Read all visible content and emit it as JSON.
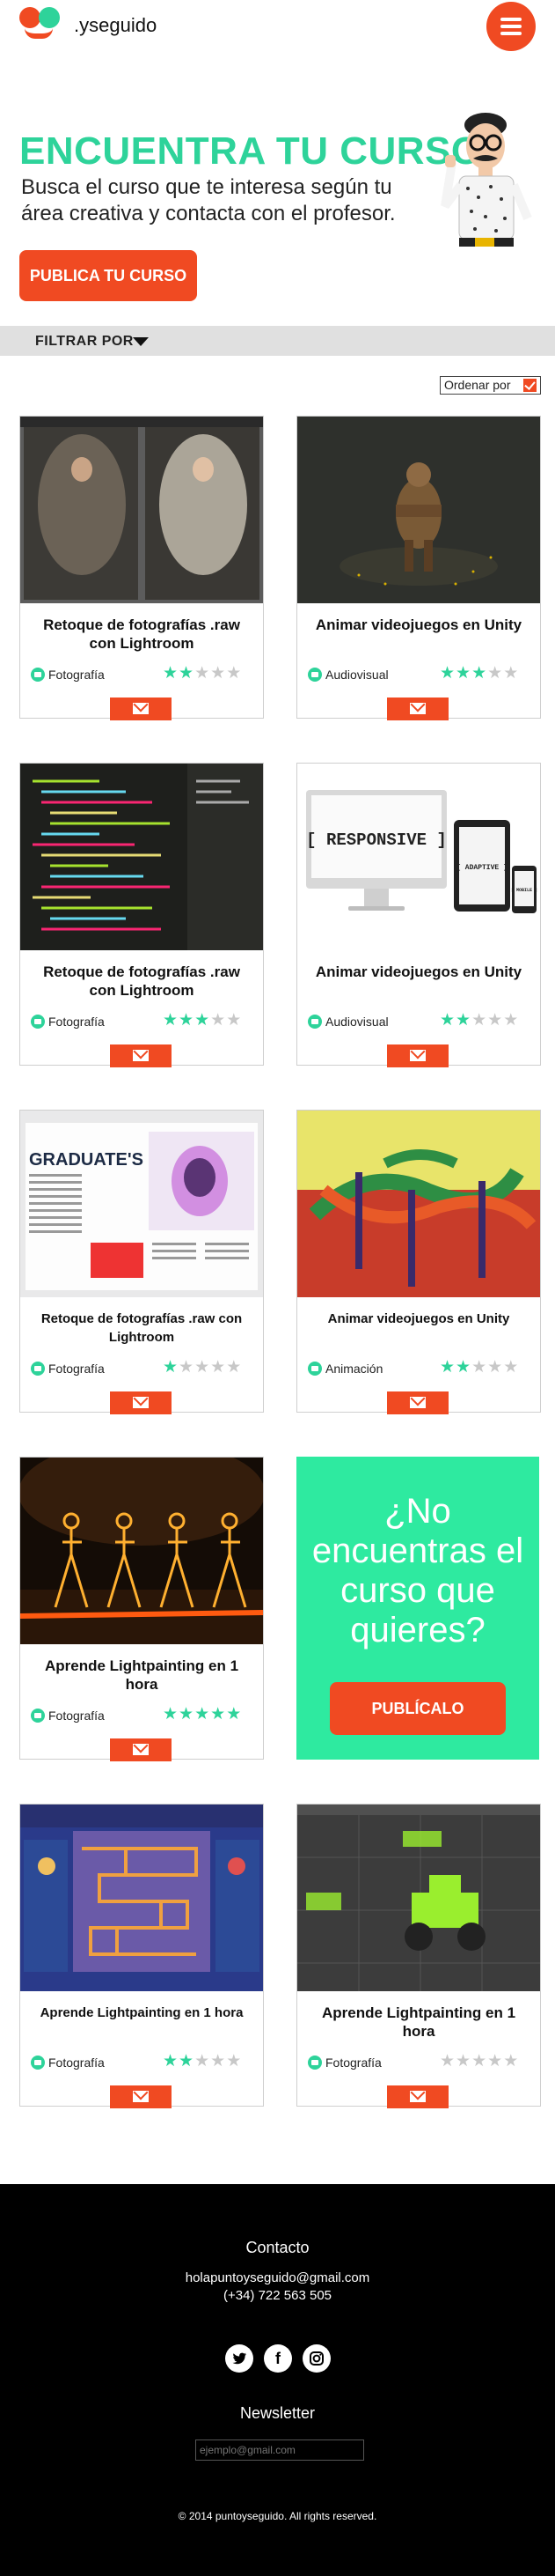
{
  "brand": {
    "name": ".yseguido"
  },
  "hero": {
    "title": "ENCUENTRA TU CURSO",
    "subtitle": "Busca el curso que te interesa según tu área creativa y contacta con el profesor.",
    "cta_label": "PUBLICA TU CURSO"
  },
  "filter": {
    "label": "FILTRAR POR",
    "order_label": "Ordenar por"
  },
  "colors": {
    "accent": "#f04a22",
    "brand_green": "#2ed39a",
    "promo_green": "#2eeaa0"
  },
  "courses": [
    {
      "title": "Retoque de fotografías .raw con Lightroom",
      "category": "Fotografía",
      "rating": 2
    },
    {
      "title": "Animar videojuegos en Unity",
      "category": "Audiovisual",
      "rating": 3
    },
    {
      "title": "Retoque de fotografías .raw con Lightroom",
      "category": "Fotografía",
      "rating": 3
    },
    {
      "title": "Animar videojuegos en Unity",
      "category": "Audiovisual",
      "rating": 2
    },
    {
      "title": "Retoque de fotografías .raw con Lightroom",
      "category": "Fotografía",
      "rating": 1
    },
    {
      "title": "Animar videojuegos en Unity",
      "category": "Animación",
      "rating": 2
    },
    {
      "title": "Aprende Lightpainting en 1 hora",
      "category": "Fotografía",
      "rating": 5
    },
    {
      "title": "Aprende Lightpainting en 1 hora",
      "category": "Fotografía",
      "rating": 2
    },
    {
      "title": "Aprende Lightpainting en 1 hora",
      "category": "Fotografía",
      "rating": 0
    }
  ],
  "image_texts": {
    "responsive": "[ RESPONSIVE ]",
    "adaptive": "[ ADAPTIVE ]",
    "mobile": "[ MOBILE ]",
    "magazine": "GRADUATE'S"
  },
  "promo": {
    "text": "¿No encuentras el curso que quieres?",
    "button_label": "PUBLÍCALO"
  },
  "footer": {
    "contact_title": "Contacto",
    "email": "holapuntoyseguido@gmail.com",
    "phone": "(+34) 722 563 505",
    "newsletter_title": "Newsletter",
    "newsletter_placeholder": "ejemplo@gmail.com",
    "copyright": "© 2014 puntoyseguido. All rights reserved."
  }
}
